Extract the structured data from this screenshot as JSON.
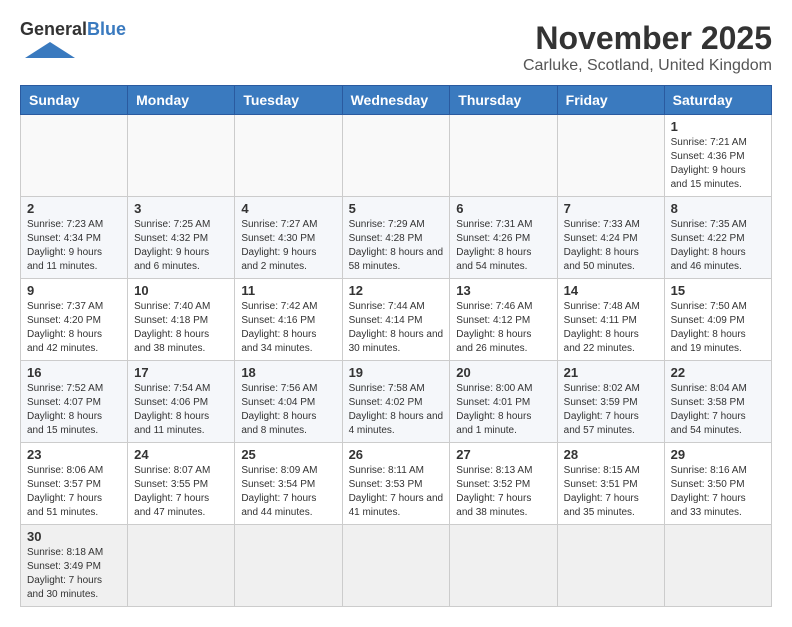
{
  "header": {
    "logo_line1": "General",
    "logo_line2": "Blue",
    "title": "November 2025",
    "subtitle": "Carluke, Scotland, United Kingdom"
  },
  "weekdays": [
    "Sunday",
    "Monday",
    "Tuesday",
    "Wednesday",
    "Thursday",
    "Friday",
    "Saturday"
  ],
  "weeks": [
    [
      {
        "day": "",
        "info": ""
      },
      {
        "day": "",
        "info": ""
      },
      {
        "day": "",
        "info": ""
      },
      {
        "day": "",
        "info": ""
      },
      {
        "day": "",
        "info": ""
      },
      {
        "day": "",
        "info": ""
      },
      {
        "day": "1",
        "info": "Sunrise: 7:21 AM\nSunset: 4:36 PM\nDaylight: 9 hours and 15 minutes."
      }
    ],
    [
      {
        "day": "2",
        "info": "Sunrise: 7:23 AM\nSunset: 4:34 PM\nDaylight: 9 hours and 11 minutes."
      },
      {
        "day": "3",
        "info": "Sunrise: 7:25 AM\nSunset: 4:32 PM\nDaylight: 9 hours and 6 minutes."
      },
      {
        "day": "4",
        "info": "Sunrise: 7:27 AM\nSunset: 4:30 PM\nDaylight: 9 hours and 2 minutes."
      },
      {
        "day": "5",
        "info": "Sunrise: 7:29 AM\nSunset: 4:28 PM\nDaylight: 8 hours and 58 minutes."
      },
      {
        "day": "6",
        "info": "Sunrise: 7:31 AM\nSunset: 4:26 PM\nDaylight: 8 hours and 54 minutes."
      },
      {
        "day": "7",
        "info": "Sunrise: 7:33 AM\nSunset: 4:24 PM\nDaylight: 8 hours and 50 minutes."
      },
      {
        "day": "8",
        "info": "Sunrise: 7:35 AM\nSunset: 4:22 PM\nDaylight: 8 hours and 46 minutes."
      }
    ],
    [
      {
        "day": "9",
        "info": "Sunrise: 7:37 AM\nSunset: 4:20 PM\nDaylight: 8 hours and 42 minutes."
      },
      {
        "day": "10",
        "info": "Sunrise: 7:40 AM\nSunset: 4:18 PM\nDaylight: 8 hours and 38 minutes."
      },
      {
        "day": "11",
        "info": "Sunrise: 7:42 AM\nSunset: 4:16 PM\nDaylight: 8 hours and 34 minutes."
      },
      {
        "day": "12",
        "info": "Sunrise: 7:44 AM\nSunset: 4:14 PM\nDaylight: 8 hours and 30 minutes."
      },
      {
        "day": "13",
        "info": "Sunrise: 7:46 AM\nSunset: 4:12 PM\nDaylight: 8 hours and 26 minutes."
      },
      {
        "day": "14",
        "info": "Sunrise: 7:48 AM\nSunset: 4:11 PM\nDaylight: 8 hours and 22 minutes."
      },
      {
        "day": "15",
        "info": "Sunrise: 7:50 AM\nSunset: 4:09 PM\nDaylight: 8 hours and 19 minutes."
      }
    ],
    [
      {
        "day": "16",
        "info": "Sunrise: 7:52 AM\nSunset: 4:07 PM\nDaylight: 8 hours and 15 minutes."
      },
      {
        "day": "17",
        "info": "Sunrise: 7:54 AM\nSunset: 4:06 PM\nDaylight: 8 hours and 11 minutes."
      },
      {
        "day": "18",
        "info": "Sunrise: 7:56 AM\nSunset: 4:04 PM\nDaylight: 8 hours and 8 minutes."
      },
      {
        "day": "19",
        "info": "Sunrise: 7:58 AM\nSunset: 4:02 PM\nDaylight: 8 hours and 4 minutes."
      },
      {
        "day": "20",
        "info": "Sunrise: 8:00 AM\nSunset: 4:01 PM\nDaylight: 8 hours and 1 minute."
      },
      {
        "day": "21",
        "info": "Sunrise: 8:02 AM\nSunset: 3:59 PM\nDaylight: 7 hours and 57 minutes."
      },
      {
        "day": "22",
        "info": "Sunrise: 8:04 AM\nSunset: 3:58 PM\nDaylight: 7 hours and 54 minutes."
      }
    ],
    [
      {
        "day": "23",
        "info": "Sunrise: 8:06 AM\nSunset: 3:57 PM\nDaylight: 7 hours and 51 minutes."
      },
      {
        "day": "24",
        "info": "Sunrise: 8:07 AM\nSunset: 3:55 PM\nDaylight: 7 hours and 47 minutes."
      },
      {
        "day": "25",
        "info": "Sunrise: 8:09 AM\nSunset: 3:54 PM\nDaylight: 7 hours and 44 minutes."
      },
      {
        "day": "26",
        "info": "Sunrise: 8:11 AM\nSunset: 3:53 PM\nDaylight: 7 hours and 41 minutes."
      },
      {
        "day": "27",
        "info": "Sunrise: 8:13 AM\nSunset: 3:52 PM\nDaylight: 7 hours and 38 minutes."
      },
      {
        "day": "28",
        "info": "Sunrise: 8:15 AM\nSunset: 3:51 PM\nDaylight: 7 hours and 35 minutes."
      },
      {
        "day": "29",
        "info": "Sunrise: 8:16 AM\nSunset: 3:50 PM\nDaylight: 7 hours and 33 minutes."
      }
    ],
    [
      {
        "day": "30",
        "info": "Sunrise: 8:18 AM\nSunset: 3:49 PM\nDaylight: 7 hours and 30 minutes."
      },
      {
        "day": "",
        "info": ""
      },
      {
        "day": "",
        "info": ""
      },
      {
        "day": "",
        "info": ""
      },
      {
        "day": "",
        "info": ""
      },
      {
        "day": "",
        "info": ""
      },
      {
        "day": "",
        "info": ""
      }
    ]
  ]
}
